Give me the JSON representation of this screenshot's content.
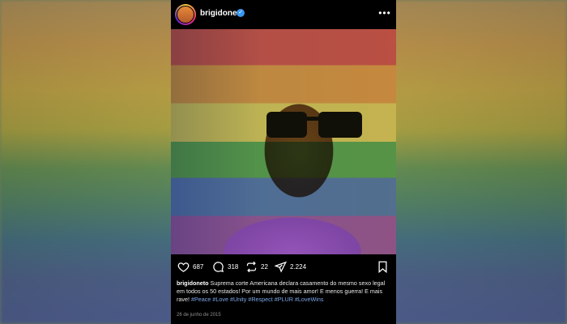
{
  "post": {
    "username": "brigidoneto",
    "more_label": "•••",
    "actions": {
      "likes": "687",
      "comments": "318",
      "reposts": "22",
      "shares": "2.224"
    },
    "caption": {
      "username": "brigidoneto",
      "text": "Suprema corte Americana declara casamento do mesmo sexo legal em todos os 50 estados! Por um mundo de mais amor! E menos guerra! E mais rave!",
      "hashtags": [
        "#Peace",
        "#Love",
        "#Unity",
        "#Respect",
        "#PLUR",
        "#LoveWins"
      ]
    },
    "date": "26 de junho de 2015"
  },
  "colors": {
    "verified": "#3897f0",
    "hashtag": "#7aa7e8",
    "rainbow": [
      "#e04a4a",
      "#f0a040",
      "#f0e060",
      "#50b050",
      "#4a78d0",
      "#a050c0"
    ]
  },
  "icons": [
    "verified-icon",
    "more-icon",
    "heart-icon",
    "comment-icon",
    "repost-icon",
    "share-icon",
    "bookmark-icon"
  ]
}
